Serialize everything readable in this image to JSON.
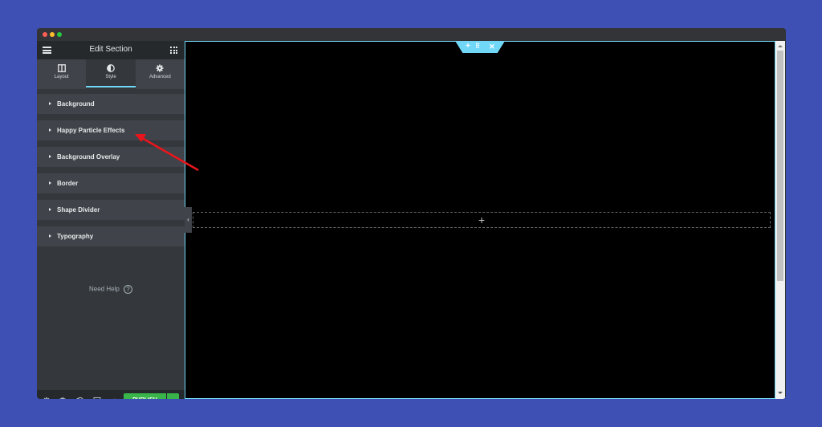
{
  "window": {
    "controls": [
      "close",
      "minimize",
      "maximize"
    ]
  },
  "panel": {
    "title": "Edit Section",
    "menu_icon": "hamburger-icon",
    "widgets_icon": "grid-icon",
    "tabs": [
      {
        "label": "Layout",
        "icon": "columns-icon",
        "active": false
      },
      {
        "label": "Style",
        "icon": "half-circle-icon",
        "active": true
      },
      {
        "label": "Advanced",
        "icon": "gear-icon",
        "active": false
      }
    ],
    "sections": [
      {
        "label": "Background"
      },
      {
        "label": "Happy Particle Effects"
      },
      {
        "label": "Background Overlay"
      },
      {
        "label": "Border"
      },
      {
        "label": "Shape Divider"
      },
      {
        "label": "Typography"
      }
    ],
    "need_help": "Need Help",
    "help_icon_glyph": "?",
    "footer": {
      "icons": [
        "settings-icon",
        "layers-icon",
        "history-icon",
        "responsive-icon",
        "preview-eye-icon"
      ],
      "publish_label": "PUBLISH"
    }
  },
  "preview": {
    "section_handle_icons": [
      "add-icon",
      "drag-icon",
      "delete-icon"
    ],
    "add_section_glyph": "+",
    "collapse_glyph": "‹"
  },
  "colors": {
    "background": "#3e50b4",
    "accent": "#71d7f7",
    "publish": "#39b54a",
    "annotation_arrow": "#e8161c"
  }
}
